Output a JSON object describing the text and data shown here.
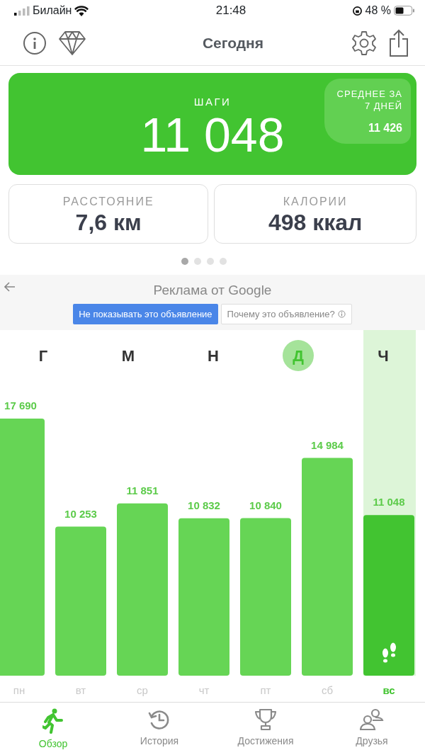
{
  "status_bar": {
    "carrier": "Билайн",
    "time": "21:48",
    "battery": "48 %"
  },
  "header": {
    "title": "Сегодня"
  },
  "steps_card": {
    "label": "ШАГИ",
    "value": "11 048",
    "average_label": "СРЕДНЕЕ ЗА 7 ДНЕЙ",
    "average_value": "11 426"
  },
  "stat_cards": [
    {
      "label": "РАССТОЯНИЕ",
      "value": "7,6 км"
    },
    {
      "label": "КАЛОРИИ",
      "value": "498 ккал"
    }
  ],
  "page_dots": [
    {
      "selected": true
    },
    {
      "selected": false
    },
    {
      "selected": false
    },
    {
      "selected": false
    }
  ],
  "ad": {
    "title": "Реклама от Google",
    "hide_button": "Не показывать это объявление",
    "why_button": "Почему это объявление?"
  },
  "ad_letters": [
    {
      "text": "Г",
      "highlighted": false
    },
    {
      "text": "М",
      "highlighted": false
    },
    {
      "text": "Н",
      "highlighted": false
    },
    {
      "text": "Д",
      "highlighted": true
    },
    {
      "text": "Ч",
      "highlighted": false
    }
  ],
  "week": {
    "days": [
      {
        "selected": false,
        "color": "#66d555"
      },
      {
        "selected": false,
        "color": "#66d555"
      },
      {
        "selected": false,
        "color": "#66d555"
      },
      {
        "selected": false,
        "color": "#66d555"
      },
      {
        "selected": false,
        "color": "#66d555"
      },
      {
        "selected": false,
        "color": "#66d555"
      },
      {
        "selected": true,
        "color": "#42c431"
      }
    ],
    "chart_data": {
      "type": "bar",
      "categories": [
        "пн",
        "вт",
        "ср",
        "чт",
        "пт",
        "сб",
        "вс"
      ],
      "series": [
        {
          "values": [
            17690,
            10253,
            11851,
            10832,
            10840,
            14984,
            11048
          ]
        }
      ],
      "data_labels": true,
      "value_labels": [
        "17 690",
        "10 253",
        "11 851",
        "10 832",
        "10 840",
        "14 984",
        "11 048"
      ]
    }
  },
  "tabs": [
    {
      "label": "Обзор",
      "selected": true,
      "kind": "runner"
    },
    {
      "label": "История",
      "selected": false,
      "kind": "history"
    },
    {
      "label": "Достижения",
      "selected": false,
      "kind": "trophy"
    },
    {
      "label": "Друзья",
      "selected": false,
      "kind": "friends"
    }
  ]
}
